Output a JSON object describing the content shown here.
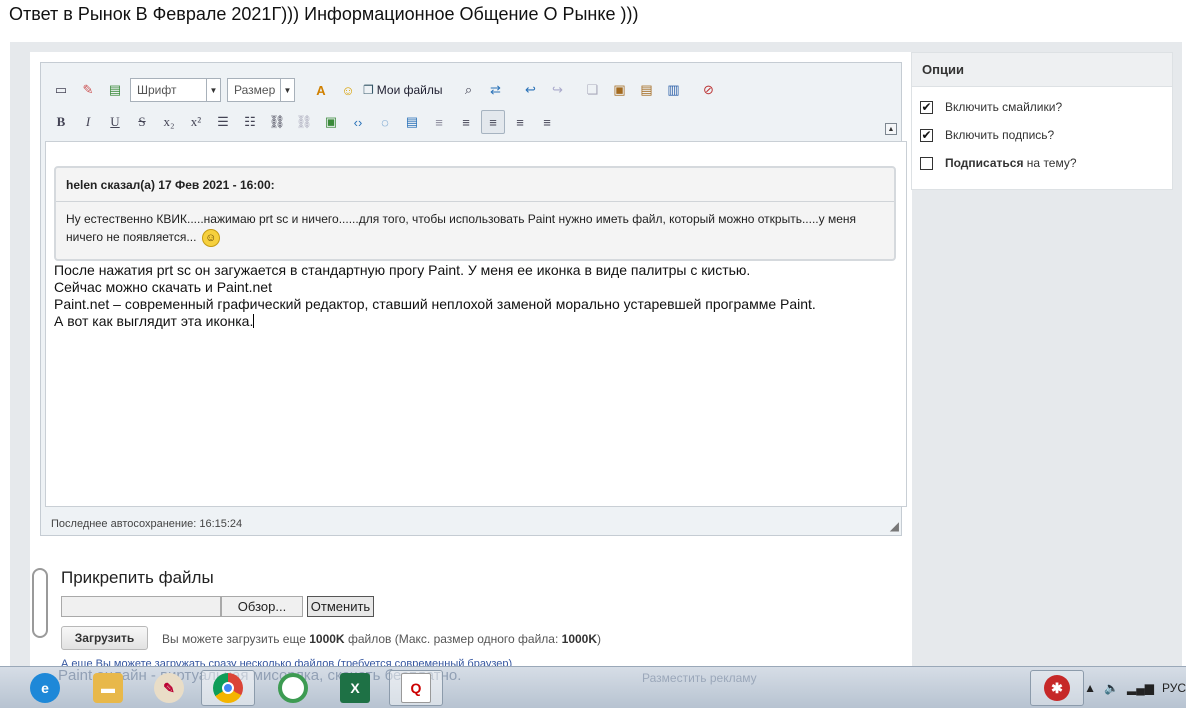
{
  "page": {
    "title": "Ответ в Рынок В Феврале 2021Г))) Информационное Общение О Рынке )))"
  },
  "toolbar": {
    "font_label": "Шрифт",
    "size_label": "Размер",
    "my_files_label": "Мои файлы",
    "icons_row1": [
      "remove-format-icon",
      "eraser-icon",
      "source-icon",
      "text-color-icon",
      "smiley-icon",
      "search-icon",
      "replace-icon",
      "undo-icon",
      "redo-icon",
      "copy-icon",
      "paste-icon",
      "paste-text-icon",
      "paste-word-icon",
      "spellcheck-icon"
    ],
    "icons_row2": [
      "bold-icon",
      "italic-icon",
      "underline-icon",
      "strikethrough-icon",
      "subscript-icon",
      "superscript-icon",
      "bullet-list-icon",
      "numbered-list-icon",
      "link-icon",
      "unlink-icon",
      "image-icon",
      "code-icon",
      "quote-icon",
      "spoiler-icon",
      "outdent-icon",
      "indent-icon",
      "align-left-icon",
      "align-center-icon",
      "align-right-icon"
    ]
  },
  "quote": {
    "header": "helen сказал(а) 17 Фев 2021 - 16:00:",
    "body": "Ну естественно КВИК.....нажимаю prt sc  и ничего......для того, чтобы использовать Paint нужно иметь файл, который можно открыть.....у меня ничего не появляется..."
  },
  "message": {
    "line1": "После нажатия prt sc он загужается в стандартную прогу Paint. У меня ее иконка в виде палитры с кистью.",
    "line2": "Сейчас можно скачать и Paint.net",
    "line3": "Paint.net – современный графический редактор, ставший неплохой заменой морально устаревшей программе Paint.",
    "line4": "А вот как выглядит эта иконка."
  },
  "editor": {
    "autosave": "Последнее автосохранение: 16:15:24"
  },
  "attach": {
    "title": "Прикрепить файлы",
    "browse_label": "Обзор...",
    "cancel_label": "Отменить",
    "upload_label": "Загрузить",
    "info_prefix": "Вы можете загрузить еще ",
    "info_count": "1000K",
    "info_mid": " файлов (Макс. размер одного файла: ",
    "info_size": "1000K",
    "info_suffix": ")",
    "multi_note": "А еще Вы можете загружать сразу несколько файлов (требуется современный браузер)"
  },
  "options": {
    "header": "Опции",
    "smileys_label": "Включить смайлики?",
    "smileys_checked": true,
    "signature_label": "Включить подпись?",
    "signature_checked": true,
    "subscribe_bold": "Подписаться",
    "subscribe_rest": " на тему?",
    "subscribe_checked": false
  },
  "taskbar": {
    "ghost_text": "Paint онлайн - виртуальная мисорлка, скачать бесплатно.",
    "ghost_text2": "Разместить рекламу",
    "tray_lang": "РУС",
    "apps": [
      "ie-icon",
      "explorer-icon",
      "paint-icon",
      "chrome-icon",
      "qlik-icon",
      "excel-icon",
      "quik-icon"
    ]
  }
}
